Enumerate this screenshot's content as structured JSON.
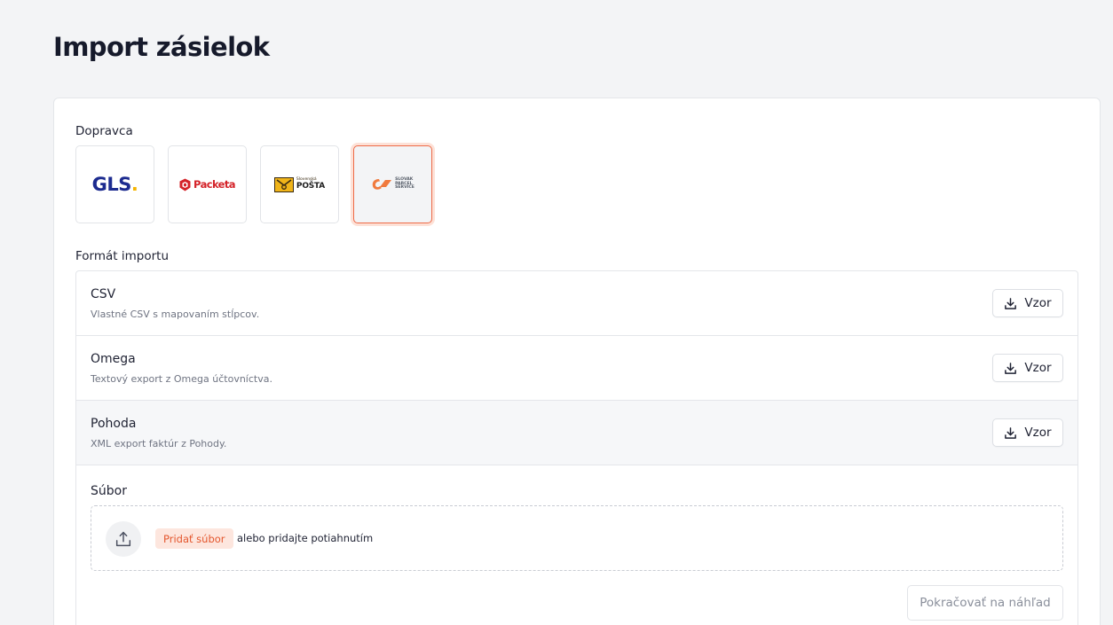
{
  "page": {
    "title": "Import zásielok"
  },
  "carriers": {
    "label": "Dopravca",
    "items": [
      {
        "id": "gls",
        "logo_text": "GLS",
        "selected": false
      },
      {
        "id": "packeta",
        "logo_text": "Packeta",
        "selected": false
      },
      {
        "id": "posta",
        "logo_text_top": "Slovenská",
        "logo_text_main": "POŠTA",
        "selected": false
      },
      {
        "id": "sps",
        "logo_lines": [
          "SLOVAK",
          "PARCEL",
          "SERVICE"
        ],
        "selected": true
      }
    ]
  },
  "formats": {
    "label": "Formát importu",
    "items": [
      {
        "title": "CSV",
        "description": "Vlastné CSV s mapovaním stĺpcov.",
        "button_label": "Vzor"
      },
      {
        "title": "Omega",
        "description": "Textový export z Omega účtovníctva.",
        "button_label": "Vzor"
      },
      {
        "title": "Pohoda",
        "description": "XML export faktúr z Pohody.",
        "button_label": "Vzor"
      }
    ]
  },
  "file": {
    "label": "Súbor",
    "add_button": "Pridať súbor",
    "drop_text": "alebo pridajte potiahnutím"
  },
  "actions": {
    "continue_label": "Pokračovať na náhľad"
  },
  "colors": {
    "accent": "#ee6a47",
    "accent_soft": "#fde6de",
    "gls_blue": "#1c2b8f",
    "gls_yellow": "#f5b400",
    "packeta_red": "#d42329",
    "posta_yellow": "#f0b419"
  }
}
